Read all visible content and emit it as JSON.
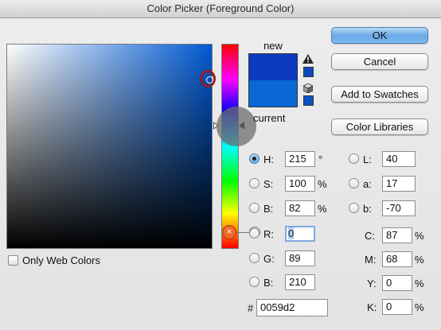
{
  "window": {
    "title": "Color Picker (Foreground Color)"
  },
  "preview": {
    "new_label": "new",
    "current_label": "current",
    "new_color": "#0c3bbd",
    "current_color": "#0b67d4"
  },
  "buttons": {
    "ok": "OK",
    "cancel": "Cancel",
    "add_to_swatches": "Add to Swatches",
    "color_libraries": "Color Libraries"
  },
  "options": {
    "only_web_colors": "Only Web Colors",
    "only_web_colors_checked": false
  },
  "hsb": {
    "h": {
      "label": "H:",
      "value": "215",
      "unit": "°",
      "selected": true
    },
    "s": {
      "label": "S:",
      "value": "100",
      "unit": "%"
    },
    "b": {
      "label": "B:",
      "value": "82",
      "unit": "%"
    }
  },
  "rgb": {
    "r": {
      "label": "R:",
      "value": "0"
    },
    "g": {
      "label": "G:",
      "value": "89"
    },
    "b": {
      "label": "B:",
      "value": "210"
    }
  },
  "lab": {
    "l": {
      "label": "L:",
      "value": "40"
    },
    "a": {
      "label": "a:",
      "value": "17"
    },
    "b": {
      "label": "b:",
      "value": "-70"
    }
  },
  "cmyk": {
    "c": {
      "label": "C:",
      "value": "87",
      "unit": "%"
    },
    "m": {
      "label": "M:",
      "value": "68",
      "unit": "%"
    },
    "y": {
      "label": "Y:",
      "value": "0",
      "unit": "%"
    },
    "k": {
      "label": "K:",
      "value": "0",
      "unit": "%"
    }
  },
  "hex": {
    "label": "#",
    "value": "0059d2"
  },
  "colors": {
    "picked": "#0059d2",
    "accent": "#6aa9e8",
    "marker": "#9a1822",
    "hue_knob": "#f06a2a"
  },
  "icons": [
    "out-of-gamut-warning-icon",
    "web-safe-cube-icon",
    "hue-slider-knob-icon"
  ]
}
